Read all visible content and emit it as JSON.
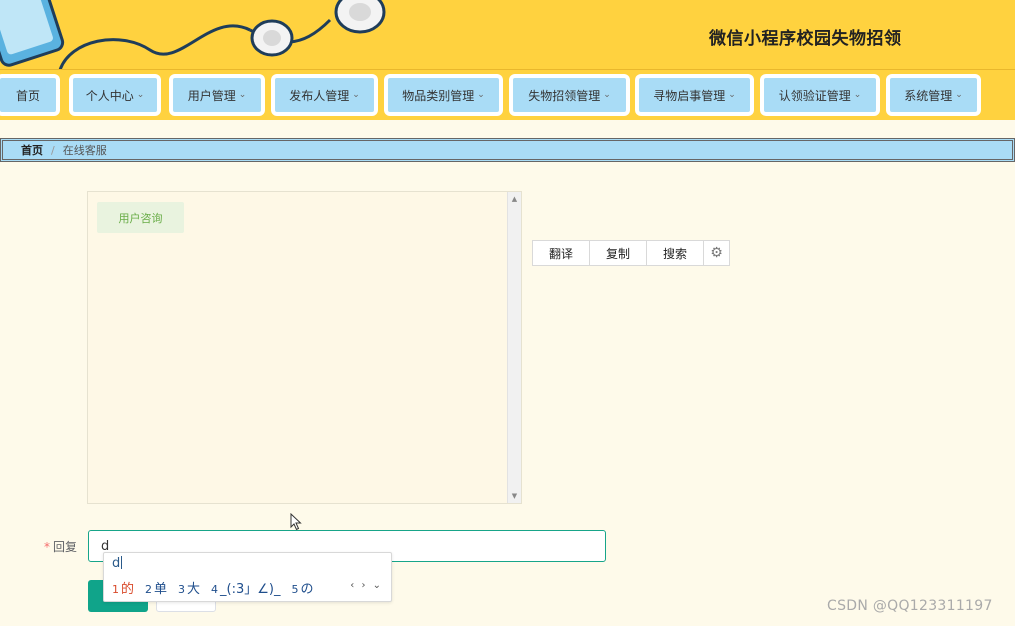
{
  "header": {
    "title": "微信小程序校园失物招领"
  },
  "nav": {
    "items": [
      {
        "label": "首页",
        "caret": ""
      },
      {
        "label": "个人中心",
        "caret": "⌄"
      },
      {
        "label": "用户管理",
        "caret": "⌄"
      },
      {
        "label": "发布人管理",
        "caret": "⌄"
      },
      {
        "label": "物品类别管理",
        "caret": "⌄"
      },
      {
        "label": "失物招领管理",
        "caret": "⌄"
      },
      {
        "label": "寻物启事管理",
        "caret": "⌄"
      },
      {
        "label": "认领验证管理",
        "caret": "⌄"
      },
      {
        "label": "系统管理",
        "caret": "⌄"
      }
    ]
  },
  "breadcrumb": {
    "home": "首页",
    "separator": "/",
    "current": "在线客服"
  },
  "chat": {
    "message": "用户咨询"
  },
  "toolbar": {
    "translate": "翻译",
    "copy": "复制",
    "search": "搜索"
  },
  "form": {
    "required_mark": "*",
    "reply_label": "回复",
    "reply_value": "d"
  },
  "ime": {
    "composition": "d",
    "candidates": [
      {
        "num": "1",
        "text": "的"
      },
      {
        "num": "2",
        "text": "单"
      },
      {
        "num": "3",
        "text": "大"
      },
      {
        "num": "4",
        "text": "_(:3」∠)_"
      },
      {
        "num": "5",
        "text": "の"
      }
    ],
    "nav": "‹ › ⌄"
  },
  "watermark": "CSDN @QQ123311197",
  "colors": {
    "header_bg": "#ffd23f",
    "nav_tab_bg": "#a9dcf6",
    "page_bg": "#fefaea",
    "primary_button": "#10a48a",
    "input_focus_border": "#17a589"
  }
}
